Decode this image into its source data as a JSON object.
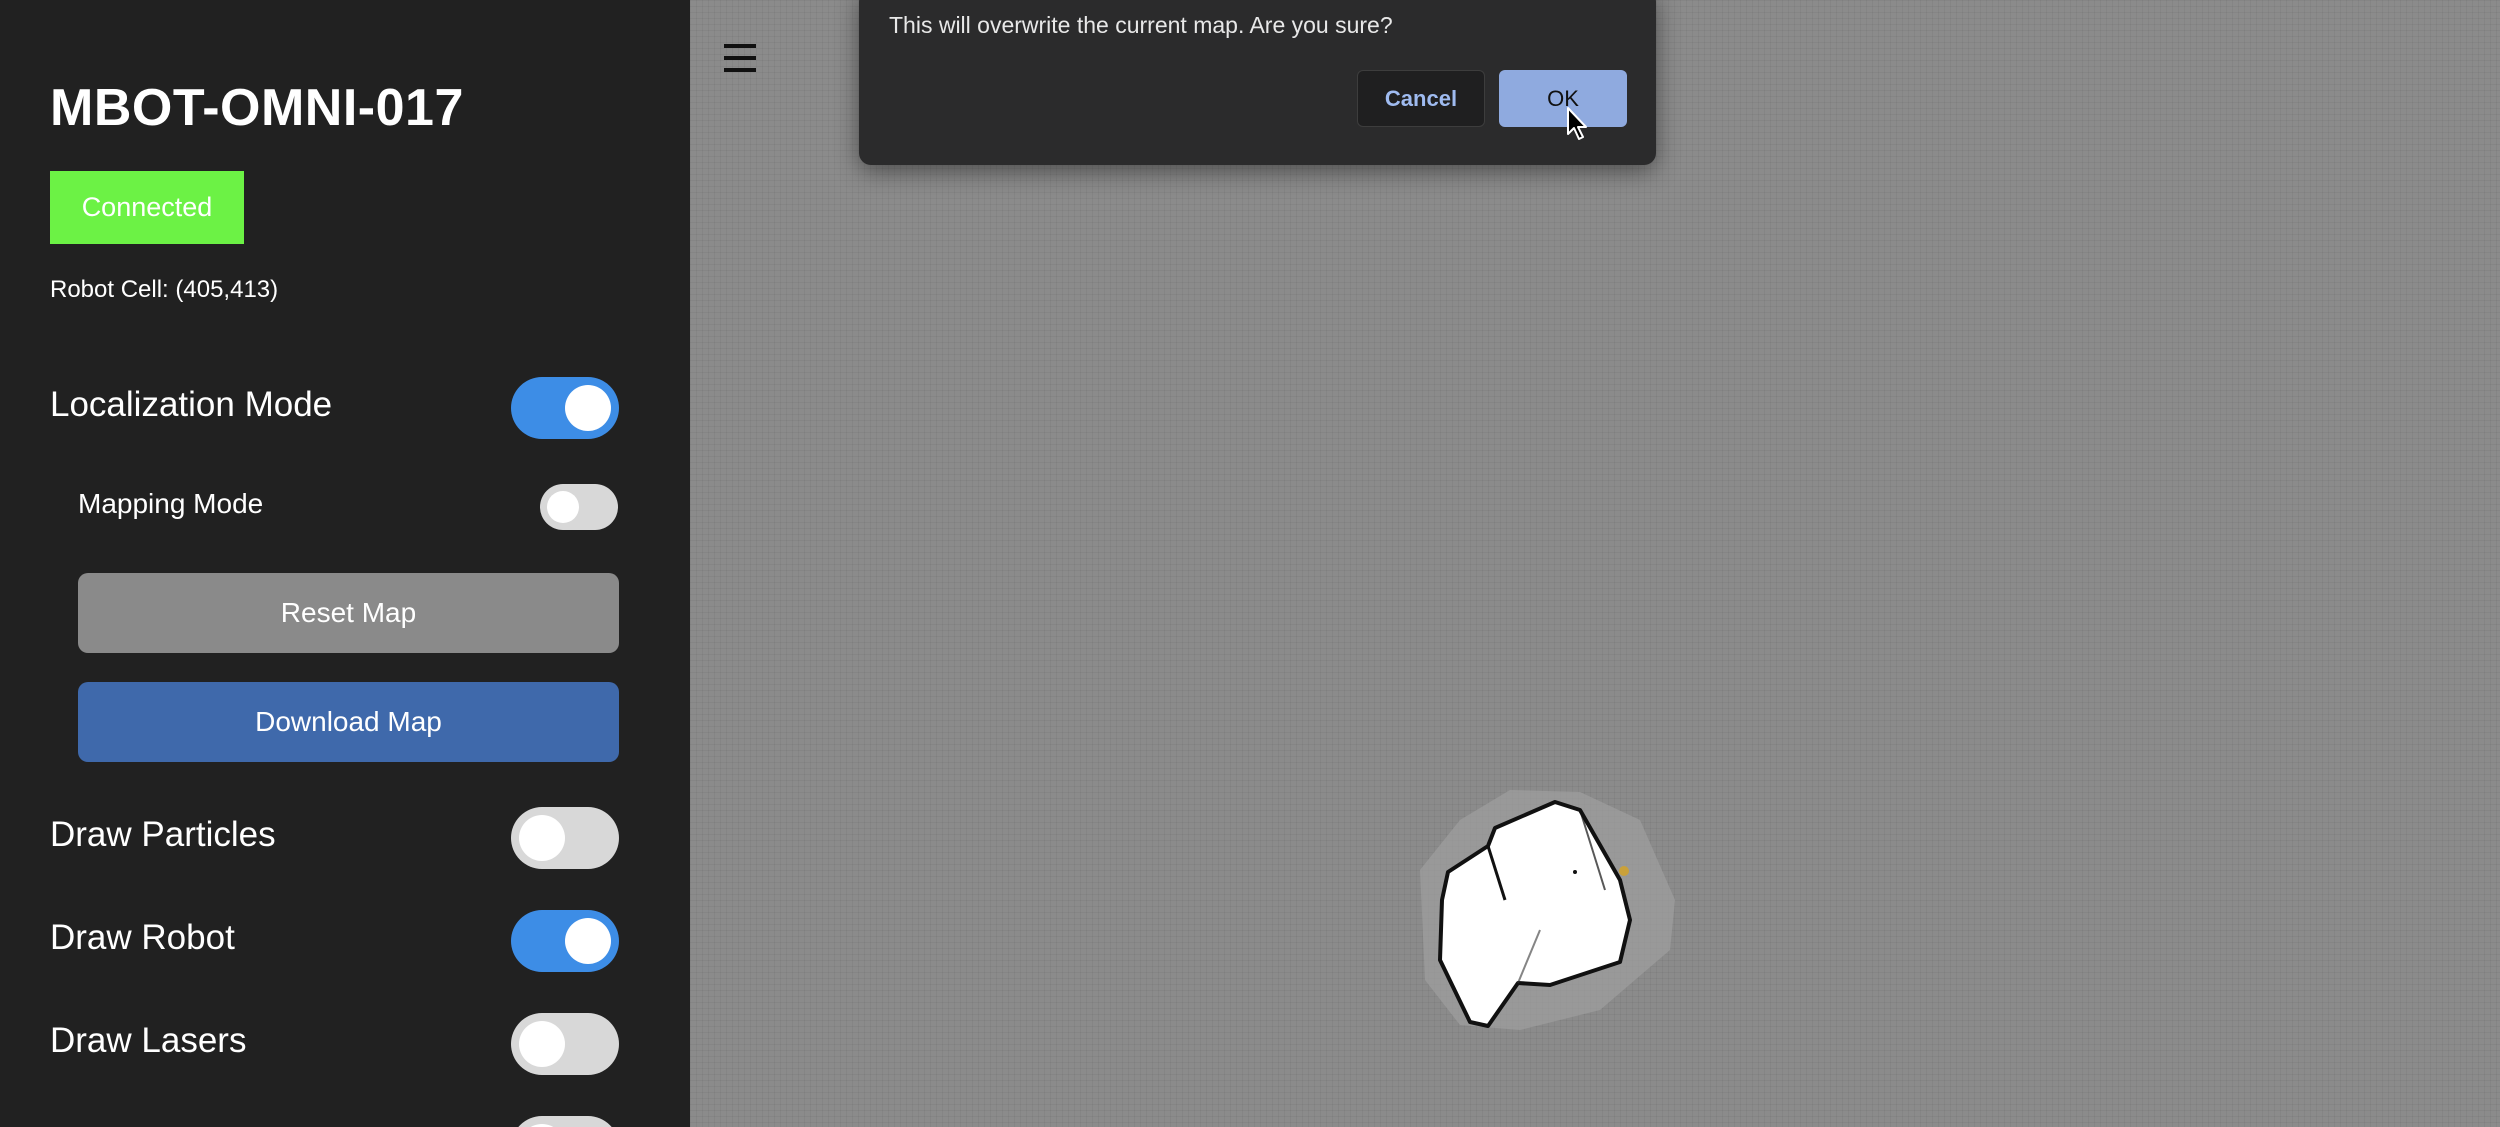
{
  "sidebar": {
    "robot_name": "MBOT-OMNI-017",
    "status": "Connected",
    "robot_cell": "Robot Cell: (405,413)",
    "localization_mode": {
      "label": "Localization Mode",
      "enabled": true
    },
    "mapping_mode": {
      "label": "Mapping Mode",
      "enabled": false
    },
    "reset_map": "Reset Map",
    "download_map": "Download Map",
    "draw_particles": {
      "label": "Draw Particles",
      "enabled": false
    },
    "draw_robot": {
      "label": "Draw Robot",
      "enabled": true
    },
    "draw_lasers": {
      "label": "Draw Lasers",
      "enabled": false
    },
    "extra_toggle": {
      "enabled": false
    }
  },
  "header": {
    "menu_icon": "hamburger-menu-icon"
  },
  "dialog": {
    "message": "This will overwrite the current map. Are you sure?",
    "cancel_label": "Cancel",
    "ok_label": "OK"
  },
  "colors": {
    "sidebar_bg": "#212121",
    "status_connected": "#6cf245",
    "toggle_on": "#3d8de6",
    "toggle_off": "#d8d8d8",
    "reset_button": "#8a8a8a",
    "download_button": "#3f69ab",
    "map_background": "#8b8b8b",
    "dialog_bg": "#2b2b2c",
    "ok_button": "#8faadf"
  }
}
